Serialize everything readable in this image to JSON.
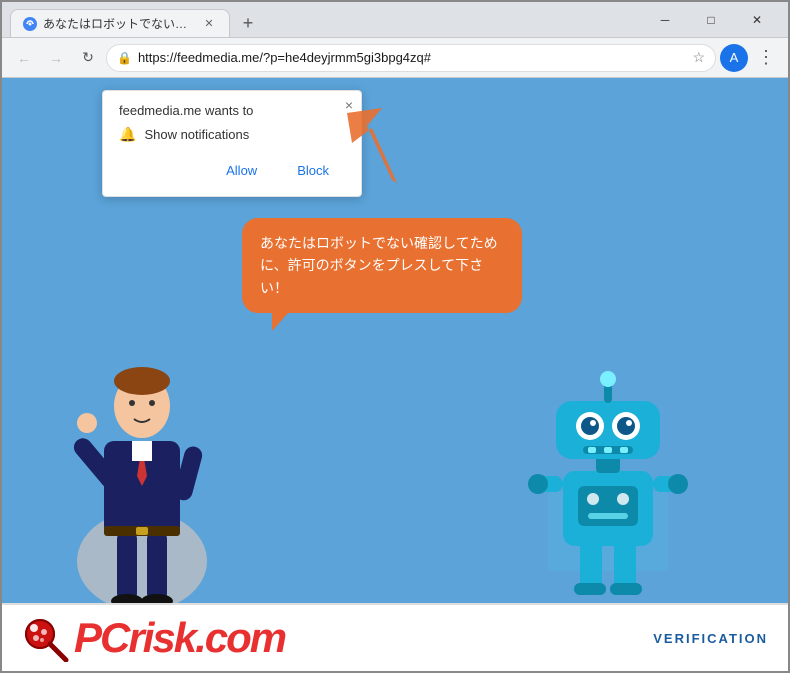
{
  "browser": {
    "tab": {
      "title": "あなたはロボットでない確認してた◎",
      "favicon_label": "C"
    },
    "new_tab_label": "+",
    "window_controls": {
      "minimize": "─",
      "maximize": "□",
      "close": "✕"
    },
    "nav": {
      "back": "←",
      "forward": "→",
      "refresh": "↻"
    },
    "url": "https://feedmedia.me/?p=he4deyjrmm5gi3bpg4zq#",
    "star": "☆",
    "profile_letter": "A",
    "menu": "⋮"
  },
  "popup": {
    "title": "feedmedia.me wants to",
    "close": "×",
    "notification_label": "Show notifications",
    "allow_label": "Allow",
    "block_label": "Block",
    "cursor": "↖"
  },
  "page": {
    "speech_text": "あなたはロボットでない確認してために、許可のボタンをプレスして下さい！",
    "verification_label": "VERIFICATION"
  },
  "pcrisk": {
    "brand_gray": "PC",
    "brand_red": "risk",
    "brand_suffix": ".com"
  },
  "colors": {
    "orange_arrow": "#e87030",
    "speech_bubble": "#e87030",
    "browser_bg": "#dee1e6",
    "page_bg": "#5ba3d9",
    "popup_bg": "#ffffff"
  }
}
